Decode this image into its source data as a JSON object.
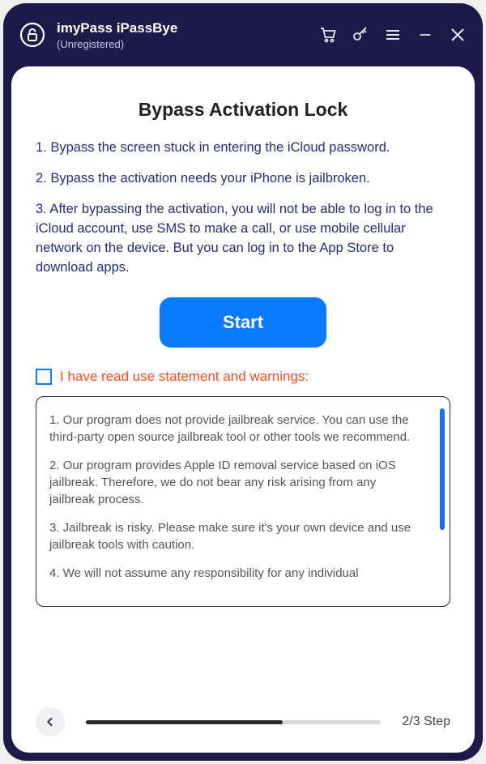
{
  "app": {
    "title": "imyPass iPassBye",
    "subtitle": "(Unregistered)"
  },
  "page": {
    "title": "Bypass Activation Lock",
    "steps": [
      "1. Bypass the screen stuck in entering the iCloud password.",
      "2. Bypass the activation needs your iPhone is jailbroken.",
      "3. After bypassing the activation, you will not be able to log in to the iCloud account, use SMS to make a call, or use mobile cellular network on the device. But you can log in to the App Store to download apps."
    ],
    "start_label": "Start",
    "agree_label": "I have read use statement and warnings:",
    "terms": [
      "1. Our program does not provide jailbreak service. You can use the third-party open source jailbreak tool or other tools we recommend.",
      "2. Our program provides Apple ID removal service based on iOS jailbreak. Therefore, we do not bear any risk arising from any jailbreak process.",
      "3. Jailbreak is risky. Please make sure it's your own device and use jailbreak tools with caution.",
      "4. We will not assume any responsibility for any individual"
    ],
    "step_indicator": "2/3 Step"
  }
}
